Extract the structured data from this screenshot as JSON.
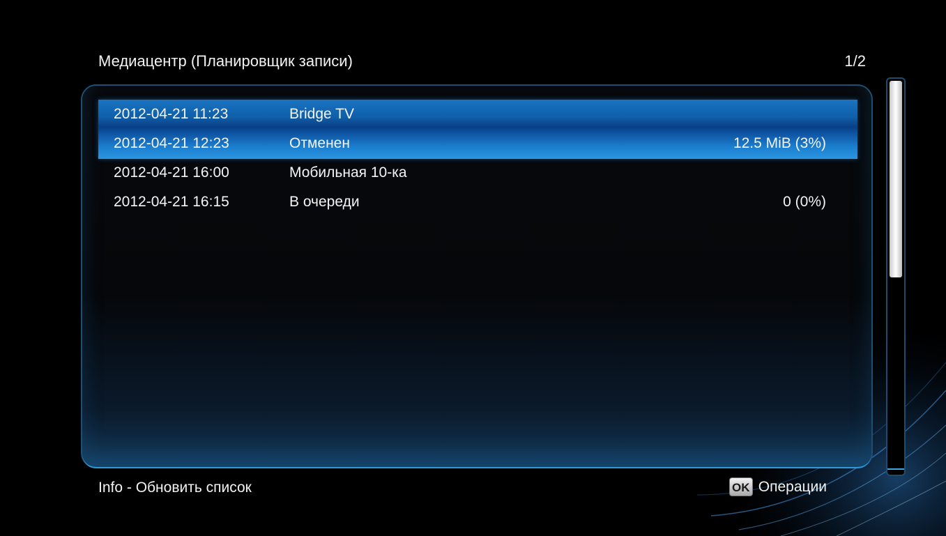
{
  "header": {
    "title": "Медиацентр (Планировщик записи)",
    "page": "1/2"
  },
  "recordings": [
    {
      "date": "2012-04-21 11:23",
      "name": "Bridge TV",
      "size": "",
      "selected": true
    },
    {
      "date": "2012-04-21 12:23",
      "name": "Отменен",
      "size": "12.5 MiB (3%)",
      "selected": true
    },
    {
      "date": "2012-04-21 16:00",
      "name": "Мобильная 10-ка",
      "size": "",
      "selected": false
    },
    {
      "date": "2012-04-21 16:15",
      "name": "В очереди",
      "size": "0 (0%)",
      "selected": false
    }
  ],
  "footer": {
    "hint_left": "Info - Обновить список",
    "ok_key": "OK",
    "ok_label": "Операции"
  },
  "scrollbar": {
    "position_fraction": 0.0,
    "visible_fraction": 0.5
  },
  "colors": {
    "selection": "#0f5ea8",
    "panel_border": "#1e4f73",
    "accent_glow": "#2f9ad9"
  }
}
